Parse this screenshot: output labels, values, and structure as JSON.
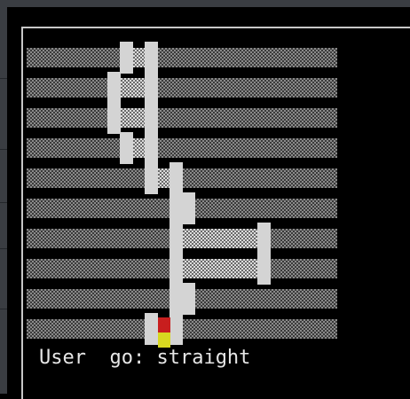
{
  "game": {
    "status_label": "User",
    "status_text": "go: straight"
  },
  "track": {
    "columns": [
      0,
      1,
      2,
      3,
      4,
      5,
      6
    ],
    "rows": [
      {
        "left_col": 2,
        "right_col": 3
      },
      {
        "left_col": 1,
        "right_col": 3
      },
      {
        "left_col": 1,
        "right_col": 3
      },
      {
        "left_col": 2,
        "right_col": 3
      },
      {
        "left_col": 3,
        "right_col": 4
      },
      {
        "left_col": 4,
        "right_col": 5
      },
      {
        "left_col": 4,
        "right_col": 6
      },
      {
        "left_col": 4,
        "right_col": 6
      },
      {
        "left_col": 4,
        "right_col": 5
      },
      {
        "left_col": 3,
        "right_col": 4
      }
    ],
    "player": {
      "row": 9,
      "col": "center"
    }
  },
  "colors": {
    "background": "#000000",
    "player_body": "#c81e1e",
    "player_feet": "#d8d820",
    "text": "#e6e6e6"
  }
}
